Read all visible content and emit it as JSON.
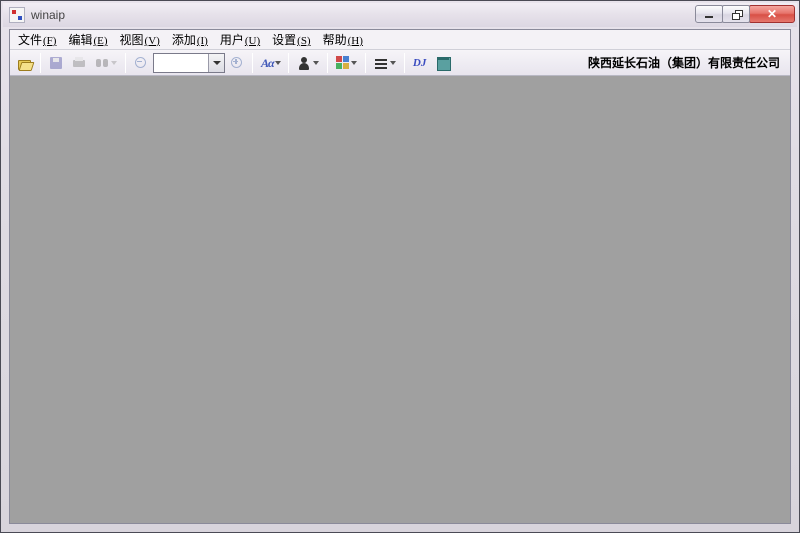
{
  "window": {
    "title": "winaip"
  },
  "menu": {
    "items": [
      {
        "label": "文件",
        "mnemonic": "(F)"
      },
      {
        "label": "编辑",
        "mnemonic": "(E)"
      },
      {
        "label": "视图",
        "mnemonic": "(V)"
      },
      {
        "label": "添加",
        "mnemonic": "(I)"
      },
      {
        "label": "用户",
        "mnemonic": "(U)"
      },
      {
        "label": "设置",
        "mnemonic": "(S)"
      },
      {
        "label": "帮助",
        "mnemonic": "(H)"
      }
    ]
  },
  "toolbar": {
    "zoom_value": "",
    "aa_label": "Aα",
    "dj_label": "DJ",
    "company_text": "陕西延长石油（集团）有限责任公司"
  }
}
